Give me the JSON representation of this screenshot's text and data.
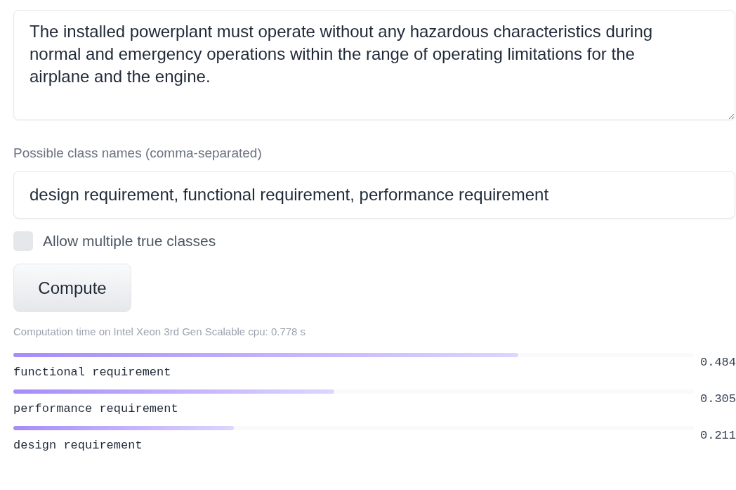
{
  "text_input": {
    "value": "The installed powerplant must operate without any hazardous characteristics during normal and emergency operations within the range of operating limitations for the airplane and the engine."
  },
  "class_names": {
    "label": "Possible class names (comma-separated)",
    "value": "design requirement, functional requirement, performance requirement"
  },
  "multi_label": {
    "label": "Allow multiple true classes",
    "checked": false
  },
  "compute_button": {
    "label": "Compute"
  },
  "computation_time": "Computation time on Intel Xeon 3rd Gen Scalable cpu: 0.778 s",
  "results": [
    {
      "label": "functional requirement",
      "score": "0.484",
      "level": 0.742
    },
    {
      "label": "performance requirement",
      "score": "0.305",
      "level": 0.472
    },
    {
      "label": "design requirement",
      "score": "0.211",
      "level": 0.324
    }
  ]
}
